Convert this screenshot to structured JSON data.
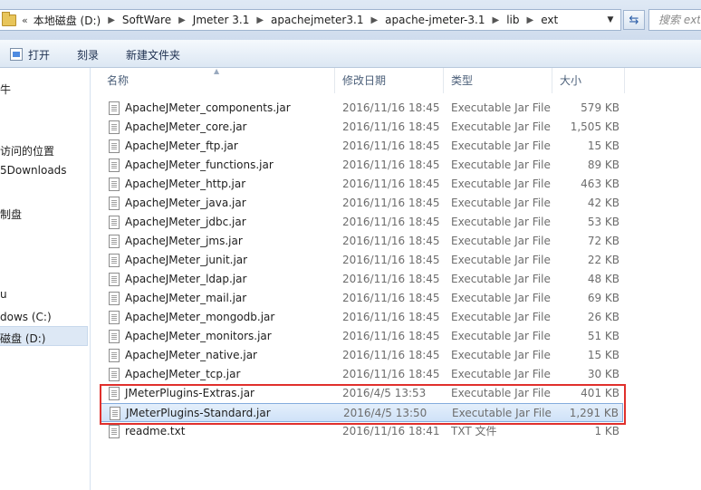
{
  "address": {
    "segments": [
      "本地磁盘 (D:)",
      "SoftWare",
      "Jmeter 3.1",
      "apachejmeter3.1",
      "apache-jmeter-3.1",
      "lib",
      "ext"
    ],
    "overflow": "«"
  },
  "search": {
    "placeholder": "搜索 ext"
  },
  "toolbar": {
    "open_label": "打开",
    "burn_label": "刻录",
    "new_folder_label": "新建文件夹"
  },
  "nav": {
    "items": [
      "牛",
      "访问的位置",
      "5Downloads",
      "制盘",
      "u",
      "dows (C:)",
      "磁盘 (D:)"
    ]
  },
  "columns": {
    "name": "名称",
    "date": "修改日期",
    "type": "类型",
    "size": "大小"
  },
  "files": [
    {
      "name": "ApacheJMeter_components.jar",
      "date": "2016/11/16 18:45",
      "type": "Executable Jar File",
      "size": "579 KB"
    },
    {
      "name": "ApacheJMeter_core.jar",
      "date": "2016/11/16 18:45",
      "type": "Executable Jar File",
      "size": "1,505 KB"
    },
    {
      "name": "ApacheJMeter_ftp.jar",
      "date": "2016/11/16 18:45",
      "type": "Executable Jar File",
      "size": "15 KB"
    },
    {
      "name": "ApacheJMeter_functions.jar",
      "date": "2016/11/16 18:45",
      "type": "Executable Jar File",
      "size": "89 KB"
    },
    {
      "name": "ApacheJMeter_http.jar",
      "date": "2016/11/16 18:45",
      "type": "Executable Jar File",
      "size": "463 KB"
    },
    {
      "name": "ApacheJMeter_java.jar",
      "date": "2016/11/16 18:45",
      "type": "Executable Jar File",
      "size": "42 KB"
    },
    {
      "name": "ApacheJMeter_jdbc.jar",
      "date": "2016/11/16 18:45",
      "type": "Executable Jar File",
      "size": "53 KB"
    },
    {
      "name": "ApacheJMeter_jms.jar",
      "date": "2016/11/16 18:45",
      "type": "Executable Jar File",
      "size": "72 KB"
    },
    {
      "name": "ApacheJMeter_junit.jar",
      "date": "2016/11/16 18:45",
      "type": "Executable Jar File",
      "size": "22 KB"
    },
    {
      "name": "ApacheJMeter_ldap.jar",
      "date": "2016/11/16 18:45",
      "type": "Executable Jar File",
      "size": "48 KB"
    },
    {
      "name": "ApacheJMeter_mail.jar",
      "date": "2016/11/16 18:45",
      "type": "Executable Jar File",
      "size": "69 KB"
    },
    {
      "name": "ApacheJMeter_mongodb.jar",
      "date": "2016/11/16 18:45",
      "type": "Executable Jar File",
      "size": "26 KB"
    },
    {
      "name": "ApacheJMeter_monitors.jar",
      "date": "2016/11/16 18:45",
      "type": "Executable Jar File",
      "size": "51 KB"
    },
    {
      "name": "ApacheJMeter_native.jar",
      "date": "2016/11/16 18:45",
      "type": "Executable Jar File",
      "size": "15 KB"
    },
    {
      "name": "ApacheJMeter_tcp.jar",
      "date": "2016/11/16 18:45",
      "type": "Executable Jar File",
      "size": "30 KB"
    },
    {
      "name": "JMeterPlugins-Extras.jar",
      "date": "2016/4/5 13:53",
      "type": "Executable Jar File",
      "size": "401 KB"
    },
    {
      "name": "JMeterPlugins-Standard.jar",
      "date": "2016/4/5 13:50",
      "type": "Executable Jar File",
      "size": "1,291 KB",
      "selected": true
    },
    {
      "name": "readme.txt",
      "date": "2016/11/16 18:41",
      "type": "TXT 文件",
      "size": "1 KB"
    }
  ],
  "colors": {
    "highlight_border": "#e0302c",
    "selection": "#cfe2f8"
  }
}
